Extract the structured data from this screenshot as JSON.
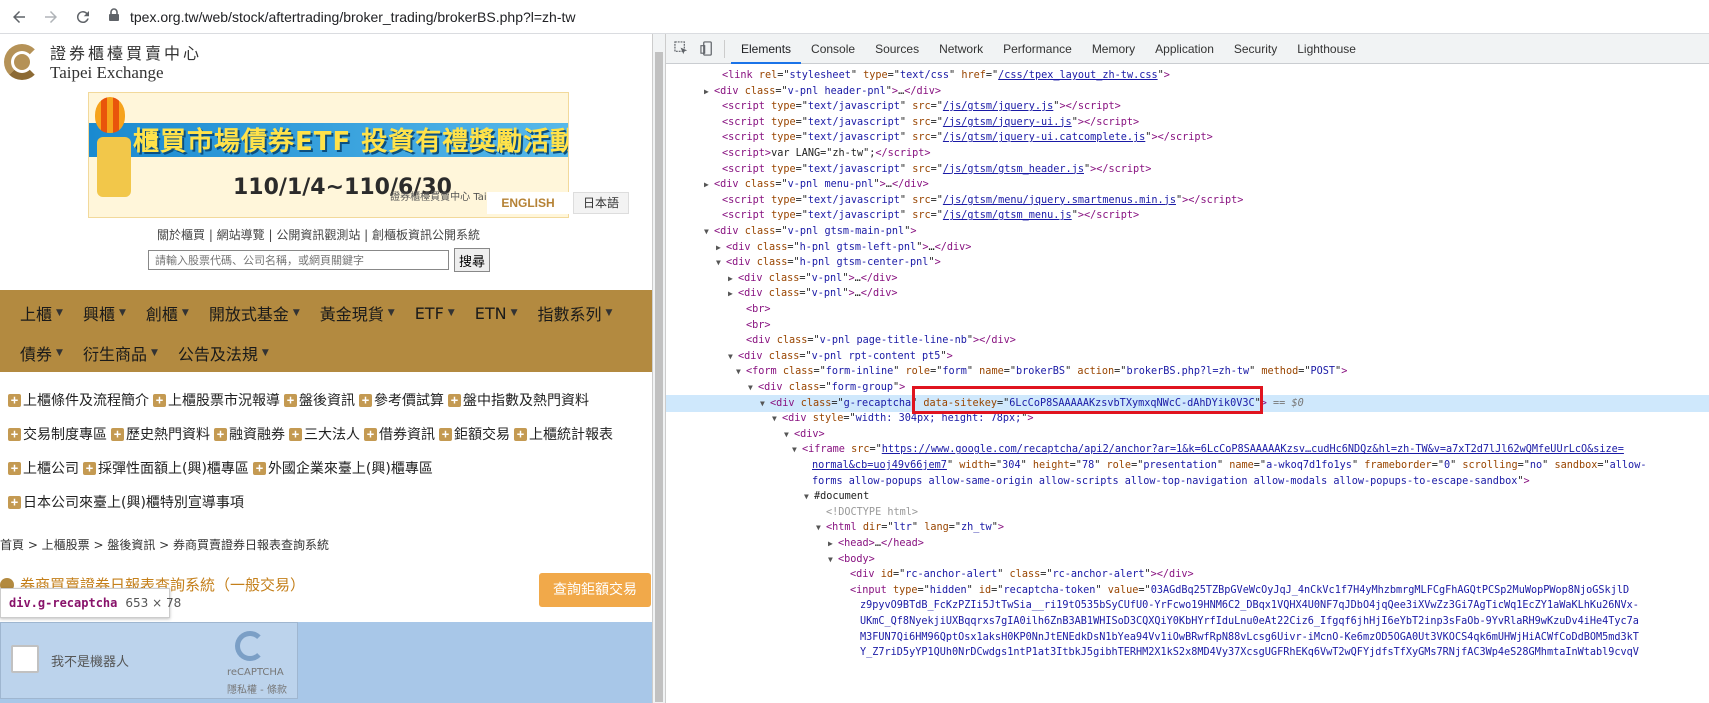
{
  "browser": {
    "url": "tpex.org.tw/web/stock/aftertrading/broker_trading/brokerBS.php?l=zh-tw"
  },
  "site": {
    "logo_zh": "證券櫃檯買賣中心",
    "logo_en": "Taipei Exchange",
    "banner_headline": "櫃買市場債券ETF 投資有禮獎勵活動",
    "banner_dates": "110/1/4~110/6/30",
    "banner_brand": "證券櫃檯買賣中心 Taipei Exchange",
    "lang_en": "ENGLISH",
    "lang_ja": "日本語",
    "top_links": "關於櫃買 | 網站導覽 | 公開資訊觀測站 | 創櫃板資訊公開系統",
    "search_placeholder": "請輸入股票代碼、公司名稱，或網頁關鍵字",
    "search_button": "搜尋",
    "menu_row_1": [
      "上櫃",
      "興櫃",
      "創櫃",
      "開放式基金",
      "黃金現貨",
      "ETF",
      "ETN",
      "指數系列"
    ],
    "menu_row_2": [
      "債券",
      "衍生商品",
      "公告及法規"
    ],
    "quick_row_1": [
      "上櫃條件及流程簡介",
      "上櫃股票市況報導",
      "盤後資訊",
      "參考價試算",
      "盤中指數及熱門資料"
    ],
    "quick_row_2": [
      "交易制度專區",
      "歷史熱門資料",
      "融資融券",
      "三大法人",
      "借券資訊",
      "鉅額交易",
      "上櫃統計報表"
    ],
    "quick_row_3": [
      "上櫃公司",
      "採彈性面額上(興)櫃專區",
      "外國企業來臺上(興)櫃專區"
    ],
    "quick_row_4": [
      "日本公司來臺上(興)櫃特別宣導事項"
    ],
    "breadcrumb": "首頁 > 上櫃股票 > 盤後資訊 > 券商買賣證券日報表查詢系統",
    "page_heading": "券商買賣證券日報表查詢系統（一般交易）",
    "quota_button": "查詢鉅額交易",
    "tooltip_name": "div.g-recaptcha",
    "tooltip_size": "653 × 78",
    "recaptcha_label": "我不是機器人",
    "recaptcha_brand": "reCAPTCHA",
    "recaptcha_privacy": "隱私權 - 條款"
  },
  "devtools": {
    "tabs": [
      "Elements",
      "Console",
      "Sources",
      "Network",
      "Performance",
      "Memory",
      "Application",
      "Security",
      "Lighthouse"
    ],
    "active_tab": "Elements",
    "lines": [
      {
        "tri": "",
        "html": "<span class='tok-tag'>&lt;link</span> <span class='tok-attr'>rel</span>=\"<span class='tok-val'>stylesheet</span>\" <span class='tok-attr'>type</span>=\"<span class='tok-val'>text/css</span>\" <span class='tok-attr'>href</span>=\"<span class='tok-link'>/css/tpex_layout_zh-tw.css</span>\"<span class='tok-tag'>&gt;</span>"
      },
      {
        "tri": "▶",
        "html": "<span class='tok-tag'>&lt;div</span> <span class='tok-attr'>class</span>=\"<span class='tok-val'>v-pnl header-pnl</span>\"<span class='tok-tag'>&gt;</span>…<span class='tok-tag'>&lt;/div&gt;</span>"
      },
      {
        "tri": "",
        "html": "<span class='tok-tag'>&lt;script</span> <span class='tok-attr'>type</span>=\"<span class='tok-val'>text/javascript</span>\" <span class='tok-attr'>src</span>=\"<span class='tok-link'>/js/gtsm/jquery.js</span>\"<span class='tok-tag'>&gt;&lt;/script&gt;</span>"
      },
      {
        "tri": "",
        "html": "<span class='tok-tag'>&lt;script</span> <span class='tok-attr'>type</span>=\"<span class='tok-val'>text/javascript</span>\" <span class='tok-attr'>src</span>=\"<span class='tok-link'>/js/gtsm/jquery-ui.js</span>\"<span class='tok-tag'>&gt;&lt;/script&gt;</span>"
      },
      {
        "tri": "",
        "html": "<span class='tok-tag'>&lt;script</span> <span class='tok-attr'>type</span>=\"<span class='tok-val'>text/javascript</span>\" <span class='tok-attr'>src</span>=\"<span class='tok-link'>/js/gtsm/jquery-ui.catcomplete.js</span>\"<span class='tok-tag'>&gt;&lt;/script&gt;</span>"
      },
      {
        "tri": "",
        "html": "<span class='tok-tag'>&lt;script&gt;</span><span class='tok-txt'>var LANG=\"zh-tw\";</span><span class='tok-tag'>&lt;/script&gt;</span>"
      },
      {
        "tri": "",
        "html": "<span class='tok-tag'>&lt;script</span> <span class='tok-attr'>type</span>=\"<span class='tok-val'>text/javascript</span>\" <span class='tok-attr'>src</span>=\"<span class='tok-link'>/js/gtsm/gtsm_header.js</span>\"<span class='tok-tag'>&gt;&lt;/script&gt;</span>"
      },
      {
        "tri": "▶",
        "html": "<span class='tok-tag'>&lt;div</span> <span class='tok-attr'>class</span>=\"<span class='tok-val'>v-pnl menu-pnl</span>\"<span class='tok-tag'>&gt;</span>…<span class='tok-tag'>&lt;/div&gt;</span>"
      },
      {
        "tri": "",
        "html": "<span class='tok-tag'>&lt;script</span> <span class='tok-attr'>type</span>=\"<span class='tok-val'>text/javascript</span>\" <span class='tok-attr'>src</span>=\"<span class='tok-link'>/js/gtsm/menu/jquery.smartmenus.min.js</span>\"<span class='tok-tag'>&gt;&lt;/script&gt;</span>"
      },
      {
        "tri": "",
        "html": "<span class='tok-tag'>&lt;script</span> <span class='tok-attr'>type</span>=\"<span class='tok-val'>text/javascript</span>\" <span class='tok-attr'>src</span>=\"<span class='tok-link'>/js/gtsm/gtsm_menu.js</span>\"<span class='tok-tag'>&gt;&lt;/script&gt;</span>"
      },
      {
        "tri": "▼",
        "html": "<span class='tok-tag'>&lt;div</span> <span class='tok-attr'>class</span>=\"<span class='tok-val'>v-pnl gtsm-main-pnl</span>\"<span class='tok-tag'>&gt;</span>"
      },
      {
        "tri": "▶",
        "html": "<span class='tok-tag'>&lt;div</span> <span class='tok-attr'>class</span>=\"<span class='tok-val'>h-pnl gtsm-left-pnl</span>\"<span class='tok-tag'>&gt;</span>…<span class='tok-tag'>&lt;/div&gt;</span>"
      },
      {
        "tri": "▼",
        "html": "<span class='tok-tag'>&lt;div</span> <span class='tok-attr'>class</span>=\"<span class='tok-val'>h-pnl gtsm-center-pnl</span>\"<span class='tok-tag'>&gt;</span>"
      },
      {
        "tri": "▶",
        "html": "<span class='tok-tag'>&lt;div</span> <span class='tok-attr'>class</span>=\"<span class='tok-val'>v-pnl</span>\"<span class='tok-tag'>&gt;</span>…<span class='tok-tag'>&lt;/div&gt;</span>"
      },
      {
        "tri": "▶",
        "html": "<span class='tok-tag'>&lt;div</span> <span class='tok-attr'>class</span>=\"<span class='tok-val'>v-pnl</span>\"<span class='tok-tag'>&gt;</span>…<span class='tok-tag'>&lt;/div&gt;</span>"
      },
      {
        "tri": "",
        "html": "<span class='tok-tag'>&lt;br&gt;</span>"
      },
      {
        "tri": "",
        "html": "<span class='tok-tag'>&lt;br&gt;</span>"
      },
      {
        "tri": "",
        "html": "<span class='tok-tag'>&lt;div</span> <span class='tok-attr'>class</span>=\"<span class='tok-val'>v-pnl page-title-line-nb</span>\"<span class='tok-tag'>&gt;&lt;/div&gt;</span>"
      },
      {
        "tri": "▼",
        "html": "<span class='tok-tag'>&lt;div</span> <span class='tok-attr'>class</span>=\"<span class='tok-val'>v-pnl rpt-content pt5</span>\"<span class='tok-tag'>&gt;</span>"
      },
      {
        "tri": "▼",
        "html": "<span class='tok-tag'>&lt;form</span> <span class='tok-attr'>class</span>=\"<span class='tok-val'>form-inline</span>\" <span class='tok-attr'>role</span>=\"<span class='tok-val'>form</span>\" <span class='tok-attr'>name</span>=\"<span class='tok-val'>brokerBS</span>\" <span class='tok-attr'>action</span>=\"<span class='tok-val'>brokerBS.php?l=zh-tw</span>\" <span class='tok-attr'>method</span>=\"<span class='tok-val'>POST</span>\"<span class='tok-tag'>&gt;</span>"
      },
      {
        "tri": "▼",
        "html": "<span class='tok-tag'>&lt;div</span> <span class='tok-attr'>class</span>=\"<span class='tok-val'>form-group</span>\"<span class='tok-tag'>&gt;</span>"
      },
      {
        "tri": "▼",
        "html": "<span class='tok-tag'>&lt;div</span> <span class='tok-attr'>class</span>=\"<span class='tok-val'>g-recaptcha</span>\" <span class='tok-attr'>data-sitekey</span>=\"<span class='tok-val'>6LcCoP8SAAAAAKzsvbTXymxqNWcC-dAhDYik0V3C</span>\"<span class='tok-tag'>&gt;</span> <span class='tok-eq'>== $0</span>"
      },
      {
        "tri": "▼",
        "html": "<span class='tok-tag'>&lt;div</span> <span class='tok-attr'>style</span>=\"<span class='tok-val'>width: 304px; height: 78px;</span>\"<span class='tok-tag'>&gt;</span>"
      },
      {
        "tri": "▼",
        "html": "<span class='tok-tag'>&lt;div&gt;</span>"
      },
      {
        "tri": "▼",
        "html": "<span class='tok-tag'>&lt;iframe</span> <span class='tok-attr'>src</span>=\"<span class='tok-link'>https://www.google.com/recaptcha/api2/anchor?ar=1&amp;k=6LcCoP8SAAAAAKzsv…cudHc6NDQz&amp;hl=zh-TW&amp;v=a7xT2d7lJl62wQMfeUUrLcO&amp;size=</span>"
      },
      {
        "tri": "",
        "html": "<span class='tok-link'>normal&amp;cb=uoj49v66jem7</span>\" <span class='tok-attr'>width</span>=\"<span class='tok-val'>304</span>\" <span class='tok-attr'>height</span>=\"<span class='tok-val'>78</span>\" <span class='tok-attr'>role</span>=\"<span class='tok-val'>presentation</span>\" <span class='tok-attr'>name</span>=\"<span class='tok-val'>a-wkoq7d1fo1ys</span>\" <span class='tok-attr'>frameborder</span>=\"<span class='tok-val'>0</span>\" <span class='tok-attr'>scrolling</span>=\"<span class='tok-val'>no</span>\" <span class='tok-attr'>sandbox</span>=\"<span class='tok-val'>allow-</span>"
      },
      {
        "tri": "",
        "html": "<span class='tok-val'>forms allow-popups allow-same-origin allow-scripts allow-top-navigation allow-modals allow-popups-to-escape-sandbox</span>\"<span class='tok-tag'>&gt;</span>"
      },
      {
        "tri": "▼",
        "html": "<span class='tok-txt'>#document</span>"
      },
      {
        "tri": "",
        "html": "<span class='tok-comment'>&lt;!DOCTYPE html&gt;</span>"
      },
      {
        "tri": "▼",
        "html": "<span class='tok-tag'>&lt;html</span> <span class='tok-attr'>dir</span>=\"<span class='tok-val'>ltr</span>\" <span class='tok-attr'>lang</span>=\"<span class='tok-val'>zh_tw</span>\"<span class='tok-tag'>&gt;</span>"
      },
      {
        "tri": "▶",
        "html": "<span class='tok-tag'>&lt;head&gt;</span>…<span class='tok-tag'>&lt;/head&gt;</span>"
      },
      {
        "tri": "▼",
        "html": "<span class='tok-tag'>&lt;body&gt;</span>"
      },
      {
        "tri": "",
        "html": "<span class='tok-tag'>&lt;div</span> <span class='tok-attr'>id</span>=\"<span class='tok-val'>rc-anchor-alert</span>\" <span class='tok-attr'>class</span>=\"<span class='tok-val'>rc-anchor-alert</span>\"<span class='tok-tag'>&gt;&lt;/div&gt;</span>"
      },
      {
        "tri": "",
        "html": "<span class='tok-tag'>&lt;input</span> <span class='tok-attr'>type</span>=\"<span class='tok-val'>hidden</span>\" <span class='tok-attr'>id</span>=\"<span class='tok-val'>recaptcha-token</span>\" <span class='tok-attr'>value</span>=\"<span class='tok-val'>03AGdBq25TZBpGVeWcOyJqJ_4nCkVc1f7H4yMhzbmrgMLFCgFhAGQtPCSp2MuWopPWop8NjoGSkjlD</span>"
      },
      {
        "tri": "",
        "html": "<span class='tok-val'>z9pyvO9BTdB_FcKzPZIi5JtTwSia__ri19tO535bSyCUfU0-YrFcwo19HNM6C2_DBqx1VQHX4U0NF7qJDbO4jqQee3iXVwZz3Gi7AgTicWq1EcZY1aWaKLhKu26NVx-</span>"
      },
      {
        "tri": "",
        "html": "<span class='tok-val'>UKmC_Qf8NyekjiUXBqqrxs7gIA0ilh6ZnB3AB1WHISoD3CQXQiY0KbHYrfIduLnu0eAt22Ciz6_Ifgqf6jhHjI6eYbT2inp3sFaOb-9YvRlaRH9wKzuDv4iHe4Tyc7a</span>"
      },
      {
        "tri": "",
        "html": "<span class='tok-val'>M3FUN7Qi6HM96QptOsx1aksH0KP0NnJtENEdkDsN1bYea94Vv1iOwBRwfRpN88vLcsg6Uivr-iMcnO-Ke6mzOD5OGA0Ut3VKOCS4qk6mUHWjHiACWfCoDdBOM5md3kT</span>"
      },
      {
        "tri": "",
        "html": "<span class='tok-val'>Y_Z7riD5yYP1QUh0NrDCwdgs1ntP1at3ItbkJ5gibhTERHM2X1kS2x8MD4Vy37XcsgUGFRhEKq6VwT2wQFYjdfsTfXyGMs7RNjfAC3Wp4eS28GMhmtaInWtabl9cvqV</span>"
      }
    ]
  }
}
